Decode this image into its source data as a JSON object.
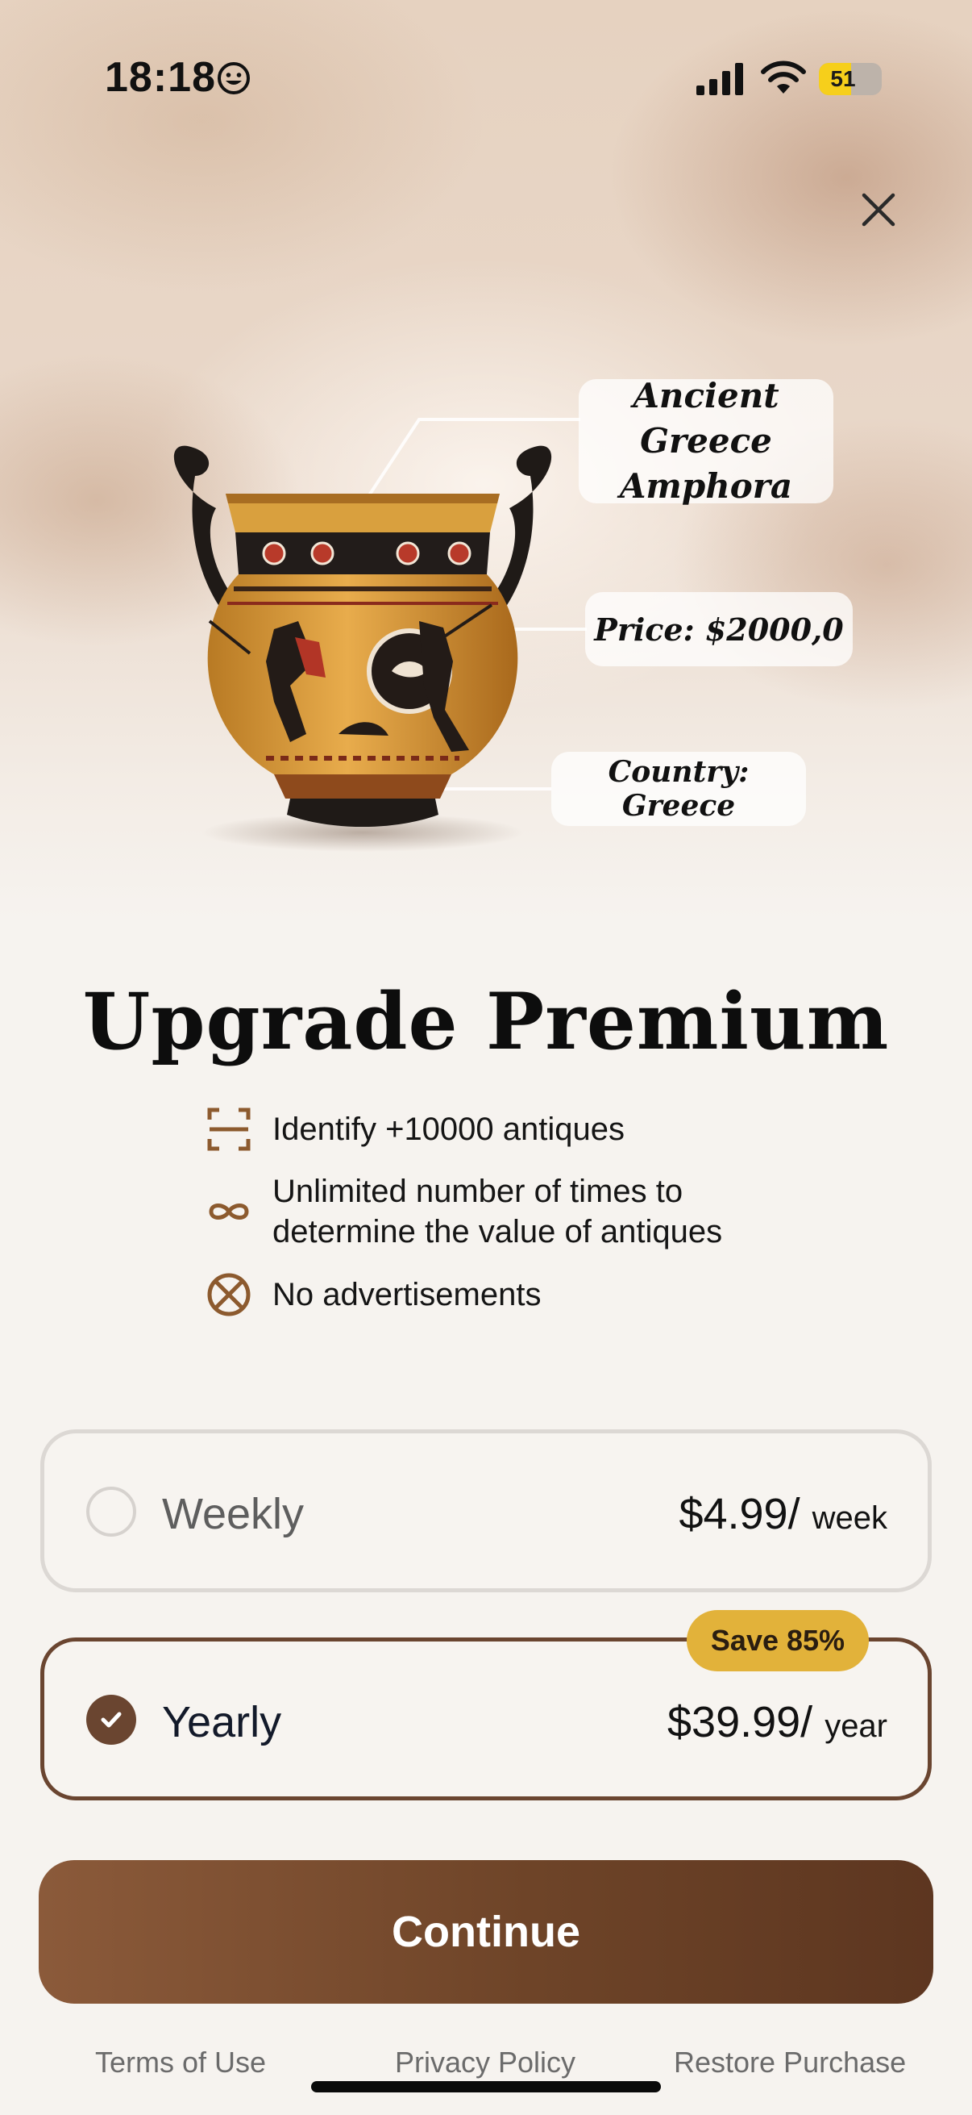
{
  "status_bar": {
    "time": "18:18",
    "battery_level": "51"
  },
  "hero": {
    "callouts": {
      "name_line1": "Ancient Greece",
      "name_line2": "Amphora",
      "price": "Price: $2000,0",
      "country": "Country: Greece"
    }
  },
  "title": "Upgrade Premium",
  "features": [
    {
      "icon": "scan-frame-icon",
      "text": "Identify +10000 antiques"
    },
    {
      "icon": "infinity-icon",
      "text_line1": "Unlimited number of times to",
      "text_line2": "determine the value of antiques"
    },
    {
      "icon": "no-ads-icon",
      "text": "No advertisements"
    }
  ],
  "plans": [
    {
      "name": "Weekly",
      "price": "$4.99/",
      "unit": "week",
      "selected": false
    },
    {
      "name": "Yearly",
      "price": "$39.99/",
      "unit": "year",
      "selected": true,
      "badge": "Save 85%"
    }
  ],
  "continue_label": "Continue",
  "footer": {
    "terms": "Terms of Use",
    "privacy": "Privacy Policy",
    "restore": "Restore Purchase"
  },
  "colors": {
    "accent_brown": "#6a4530",
    "badge_gold": "#e2b23a",
    "battery_yellow": "#f6cf1b"
  }
}
